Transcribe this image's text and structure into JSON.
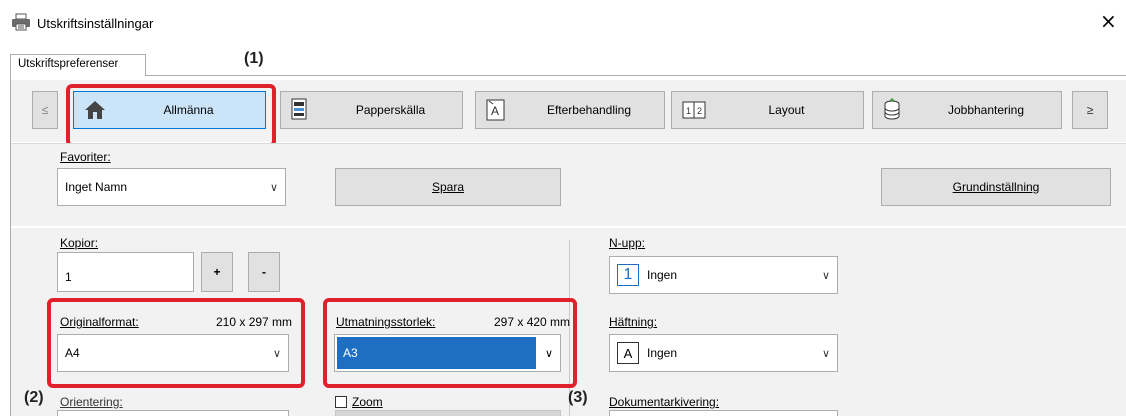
{
  "window": {
    "title": "Utskriftsinställningar",
    "close": "×"
  },
  "tab": {
    "label": "Utskriftspreferenser"
  },
  "toolbar": {
    "prev": "≤",
    "next": "≥",
    "buttons": [
      {
        "label": "Allmänna",
        "icon": "home-icon"
      },
      {
        "label": "Papperskälla",
        "icon": "paper-tray-icon"
      },
      {
        "label": "Efterbehandling",
        "icon": "finishing-icon"
      },
      {
        "label": "Layout",
        "icon": "layout-icon",
        "icon_text": "1|2"
      },
      {
        "label": "Jobbhantering",
        "icon": "job-handling-icon"
      }
    ]
  },
  "favorites": {
    "label": "Favoriter:",
    "value": "Inget Namn",
    "save": "Spara",
    "default": "Grundinställning"
  },
  "copies": {
    "label": "Kopior:",
    "value": "1",
    "plus": "+",
    "minus": "-"
  },
  "original_size": {
    "label": "Originalformat:",
    "dims": "210 x 297 mm",
    "value": "A4"
  },
  "output_size": {
    "label": "Utmatningsstorlek:",
    "dims": "297 x 420 mm",
    "value": "A3"
  },
  "orientation": {
    "label": "Orientering:"
  },
  "zoom": {
    "label": "Zoom"
  },
  "nup": {
    "label": "N-upp:",
    "icon_text": "1",
    "value": "Ingen"
  },
  "stapling": {
    "label": "Häftning:",
    "icon_text": "A",
    "value": "Ingen"
  },
  "archiving": {
    "label": "Dokumentarkivering:"
  },
  "callouts": {
    "c1": "(1)",
    "c2": "(2)",
    "c3": "(3)"
  },
  "colors": {
    "accent": "#0078d7",
    "selected_bg": "#cce4f7",
    "highlight": "#e0202a",
    "dropdown_selected": "#1e6fc4"
  }
}
